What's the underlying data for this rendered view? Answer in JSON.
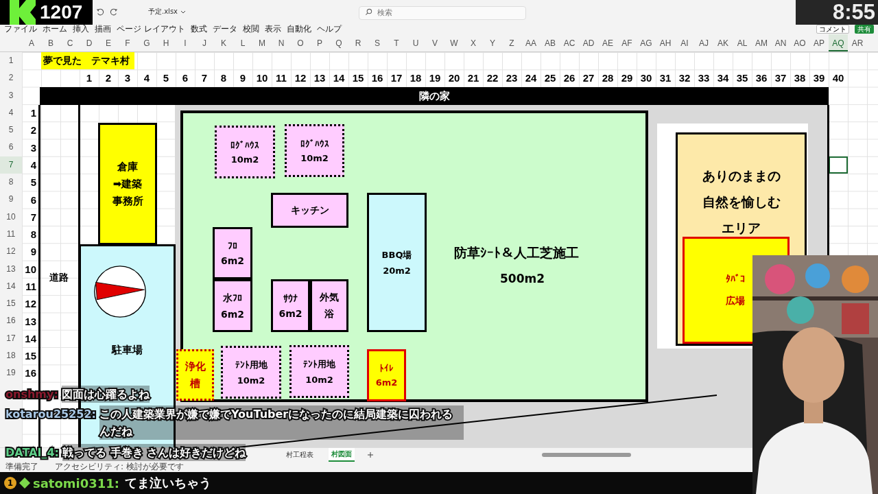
{
  "stream": {
    "counter": "1207",
    "clock": "8:55"
  },
  "excel": {
    "file_name": "予定.xlsx",
    "search": {
      "placeholder": "検索"
    },
    "menu": [
      "ファイル",
      "ホーム",
      "挿入",
      "描画",
      "ページ レイアウト",
      "数式",
      "データ",
      "校閲",
      "表示",
      "自動化",
      "ヘルプ"
    ],
    "comment_button": "コメント",
    "share_button": "共有"
  },
  "sheet": {
    "columns": [
      {
        "label": "A",
        "selected": false
      },
      {
        "label": "B",
        "selected": false
      },
      {
        "label": "C",
        "selected": false
      },
      {
        "label": "D",
        "selected": false
      },
      {
        "label": "E",
        "selected": false
      },
      {
        "label": "F",
        "selected": false
      },
      {
        "label": "G",
        "selected": false
      },
      {
        "label": "H",
        "selected": false
      },
      {
        "label": "I",
        "selected": false
      },
      {
        "label": "J",
        "selected": false
      },
      {
        "label": "K",
        "selected": false
      },
      {
        "label": "L",
        "selected": false
      },
      {
        "label": "M",
        "selected": false
      },
      {
        "label": "N",
        "selected": false
      },
      {
        "label": "O",
        "selected": false
      },
      {
        "label": "P",
        "selected": false
      },
      {
        "label": "Q",
        "selected": false
      },
      {
        "label": "R",
        "selected": false
      },
      {
        "label": "S",
        "selected": false
      },
      {
        "label": "T",
        "selected": false
      },
      {
        "label": "U",
        "selected": false
      },
      {
        "label": "V",
        "selected": false
      },
      {
        "label": "W",
        "selected": false
      },
      {
        "label": "X",
        "selected": false
      },
      {
        "label": "Y",
        "selected": false
      },
      {
        "label": "Z",
        "selected": false
      },
      {
        "label": "AA",
        "selected": false
      },
      {
        "label": "AB",
        "selected": false
      },
      {
        "label": "AC",
        "selected": false
      },
      {
        "label": "AD",
        "selected": false
      },
      {
        "label": "AE",
        "selected": false
      },
      {
        "label": "AF",
        "selected": false
      },
      {
        "label": "AG",
        "selected": false
      },
      {
        "label": "AH",
        "selected": false
      },
      {
        "label": "AI",
        "selected": false
      },
      {
        "label": "AJ",
        "selected": false
      },
      {
        "label": "AK",
        "selected": false
      },
      {
        "label": "AL",
        "selected": false
      },
      {
        "label": "AM",
        "selected": false
      },
      {
        "label": "AN",
        "selected": false
      },
      {
        "label": "AO",
        "selected": false
      },
      {
        "label": "AP",
        "selected": false
      },
      {
        "label": "AQ",
        "selected": true
      },
      {
        "label": "AR",
        "selected": false
      }
    ],
    "rows": [
      {
        "label": "1",
        "selected": false
      },
      {
        "label": "2",
        "selected": false
      },
      {
        "label": "3",
        "selected": false
      },
      {
        "label": "4",
        "selected": false
      },
      {
        "label": "5",
        "selected": false
      },
      {
        "label": "6",
        "selected": false
      },
      {
        "label": "7",
        "selected": true
      },
      {
        "label": "8",
        "selected": false
      },
      {
        "label": "9",
        "selected": false
      },
      {
        "label": "10",
        "selected": false
      },
      {
        "label": "11",
        "selected": false
      },
      {
        "label": "12",
        "selected": false
      },
      {
        "label": "13",
        "selected": false
      },
      {
        "label": "14",
        "selected": false
      },
      {
        "label": "15",
        "selected": false
      },
      {
        "label": "16",
        "selected": false
      },
      {
        "label": "17",
        "selected": false
      },
      {
        "label": "18",
        "selected": false
      },
      {
        "label": "19",
        "selected": false
      }
    ],
    "title": "夢で見た　テマキ村",
    "grid_numbers": [
      "1",
      "2",
      "3",
      "4",
      "5",
      "6",
      "7",
      "8",
      "9",
      "10",
      "11",
      "12",
      "13",
      "14",
      "15",
      "16",
      "17",
      "18",
      "19",
      "20",
      "21",
      "22",
      "23",
      "24",
      "25",
      "26",
      "27",
      "28",
      "29",
      "30",
      "31",
      "32",
      "33",
      "34",
      "35",
      "36",
      "37",
      "38",
      "39",
      "40"
    ],
    "row_numbers": [
      "1",
      "2",
      "3",
      "4",
      "5",
      "6",
      "7",
      "8",
      "9",
      "10",
      "11",
      "12",
      "13",
      "14",
      "15",
      "16"
    ],
    "plan": {
      "header": "隣の家",
      "road": "道路",
      "parking": "駐車場",
      "warehouse": [
        "倉庫",
        "➡建築",
        "事務所"
      ],
      "field": {
        "title": "防草ｼｰﾄ＆人工芝施工",
        "area": "500m2"
      },
      "facilities": [
        {
          "kind": "dotted",
          "lines": [
            "ﾛｸﾞﾊｳｽ",
            "10m2"
          ]
        },
        {
          "kind": "dotted",
          "lines": [
            "ﾛｸﾞﾊｳｽ",
            "10m2"
          ]
        },
        {
          "kind": "solid",
          "lines": [
            "キッチン"
          ]
        },
        {
          "kind": "solid",
          "lines": [
            "ﾌﾛ",
            "6m2"
          ]
        },
        {
          "kind": "solid",
          "lines": [
            "水ﾌﾛ",
            "6m2"
          ]
        },
        {
          "kind": "solid",
          "lines": [
            "ｻｳﾅ",
            "6m2"
          ]
        },
        {
          "kind": "solid",
          "lines": [
            "外気",
            "浴"
          ]
        },
        {
          "kind": "bbq",
          "lines": [
            "BBQ場",
            "20m2"
          ]
        },
        {
          "kind": "septic",
          "lines": [
            "浄化",
            "槽"
          ]
        },
        {
          "kind": "dotted",
          "lines": [
            "ﾃﾝﾄ用地",
            "10m2"
          ]
        },
        {
          "kind": "dotted",
          "lines": [
            "ﾃﾝﾄ用地",
            "10m2"
          ]
        },
        {
          "kind": "toilet",
          "lines": [
            "ﾄｲﾚ",
            "6m2"
          ]
        }
      ],
      "nature_area": [
        "ありのままの",
        "自然を愉しむ",
        "エリア"
      ],
      "smoking_area": [
        "ﾀﾊﾞｺ",
        "広場"
      ]
    }
  },
  "sheet_tabs": [
    {
      "label": "村工程表",
      "selected": false
    },
    {
      "label": "村図面",
      "selected": true
    }
  ],
  "status": [
    "準備完了",
    "アクセシビリティ: 検討が必要です"
  ],
  "chat": [
    {
      "user": "onshmy:",
      "color": "#8a1a2e",
      "message": "図面は心躍るよね"
    },
    {
      "user": "kotarou25252:",
      "color": "#a9c8e6",
      "message": "この人建築業界が嫌で嫌でYouTuberになったのに結局建築に囚われるんだね"
    },
    {
      "user": "DATAI_4:",
      "color": "#5fd08a",
      "message": "戦ってる 手巻き さんは好きだけどね"
    }
  ],
  "highlight_chat": {
    "badge": "1",
    "user": "satomi0311:",
    "message": "てま泣いちゃう"
  }
}
